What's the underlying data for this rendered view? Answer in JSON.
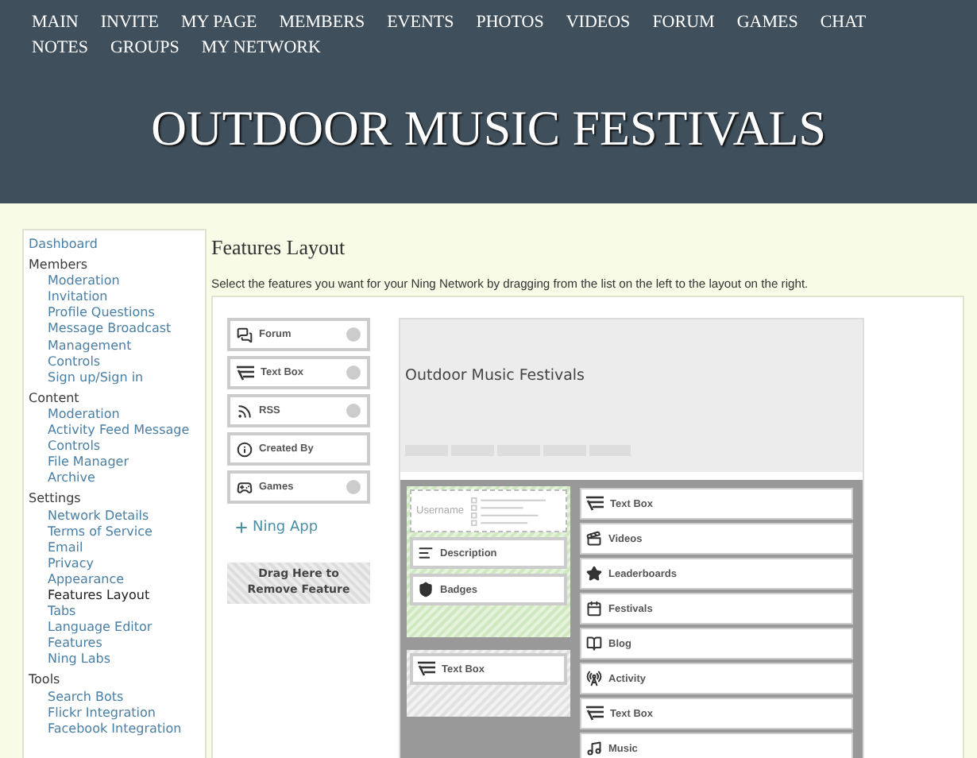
{
  "nav": [
    "MAIN",
    "INVITE",
    "MY PAGE",
    "MEMBERS",
    "EVENTS",
    "PHOTOS",
    "VIDEOS",
    "FORUM",
    "GAMES",
    "CHAT",
    "NOTES",
    "GROUPS",
    "MY NETWORK"
  ],
  "site_title": "OUTDOOR MUSIC FESTIVALS",
  "sidebar": [
    {
      "label": "Dashboard",
      "selected": false
    },
    {
      "label": "Members",
      "children": [
        {
          "label": "Moderation",
          "selected": false
        },
        {
          "label": "Invitation",
          "selected": false
        },
        {
          "label": "Profile Questions",
          "selected": false
        },
        {
          "label": "Message Broadcast",
          "selected": false
        },
        {
          "label": "Management",
          "selected": false
        },
        {
          "label": "Controls",
          "selected": false
        },
        {
          "label": "Sign up/Sign in",
          "selected": false
        }
      ]
    },
    {
      "label": "Content",
      "children": [
        {
          "label": "Moderation",
          "selected": false
        },
        {
          "label": "Activity Feed Message",
          "selected": false
        },
        {
          "label": "Controls",
          "selected": false
        },
        {
          "label": "File Manager",
          "selected": false
        },
        {
          "label": "Archive",
          "selected": false
        }
      ]
    },
    {
      "label": "Settings",
      "children": [
        {
          "label": "Network Details",
          "selected": false
        },
        {
          "label": "Terms of Service",
          "selected": false
        },
        {
          "label": "Email",
          "selected": false
        },
        {
          "label": "Privacy",
          "selected": false
        },
        {
          "label": "Appearance",
          "selected": false
        },
        {
          "label": "Features Layout",
          "selected": true
        },
        {
          "label": "Tabs",
          "selected": false
        },
        {
          "label": "Language Editor",
          "selected": false
        },
        {
          "label": "Features",
          "selected": false
        },
        {
          "label": "Ning Labs",
          "selected": false
        }
      ]
    },
    {
      "label": "Tools",
      "children": [
        {
          "label": "Search Bots",
          "selected": false
        },
        {
          "label": "Flickr Integration",
          "selected": false
        },
        {
          "label": "Facebook Integration",
          "selected": false
        }
      ]
    }
  ],
  "heading": "Features Layout",
  "description": "Select the features you want for your Ning Network by dragging from the list on the left to the layout on the right.",
  "palette": [
    {
      "label": "Forum",
      "kind": "forum"
    },
    {
      "label": "Text Box",
      "kind": "textbox"
    },
    {
      "label": "RSS",
      "kind": "rss"
    },
    {
      "label": "Created By",
      "kind": "info"
    },
    {
      "label": "Games",
      "kind": "games"
    }
  ],
  "add_app": "Ning App",
  "remove_zone": "Drag Here to Remove Feature",
  "preview": {
    "title": "Outdoor Music Festivals",
    "left_sections": [
      {
        "locked": true,
        "items": [
          {
            "label": "Username",
            "kind": "profile"
          },
          {
            "label": "Description",
            "kind": "description"
          },
          {
            "label": "Badges",
            "kind": "badges"
          }
        ]
      },
      {
        "locked": false,
        "items": [
          {
            "label": "Text Box",
            "kind": "textbox"
          }
        ]
      }
    ],
    "right_items": [
      {
        "label": "Text Box",
        "kind": "textbox"
      },
      {
        "label": "Videos",
        "kind": "videos"
      },
      {
        "label": "Leaderboards",
        "kind": "star"
      },
      {
        "label": "Festivals",
        "kind": "calendar"
      },
      {
        "label": "Blog",
        "kind": "blog"
      },
      {
        "label": "Activity",
        "kind": "activity"
      },
      {
        "label": "Text Box",
        "kind": "textbox"
      },
      {
        "label": "Music",
        "kind": "music"
      }
    ]
  }
}
